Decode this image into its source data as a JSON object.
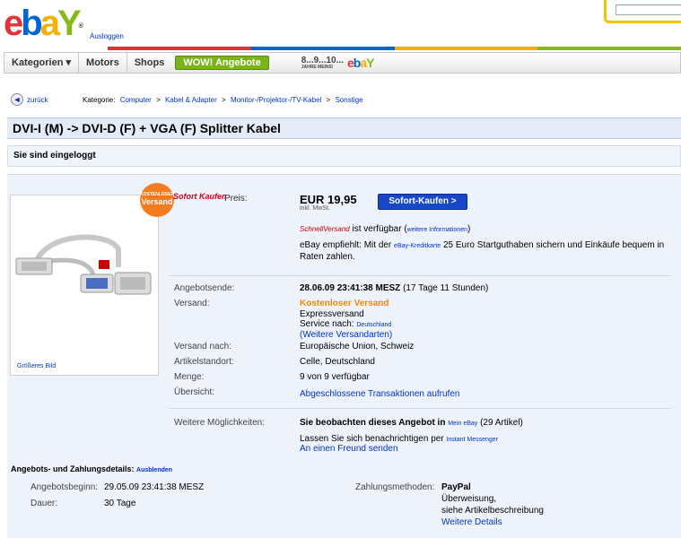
{
  "header": {
    "logout": "Ausloggen",
    "brand_colors": [
      "#e53238",
      "#0064d2",
      "#f5af02",
      "#86b817"
    ],
    "search_placeholder": ""
  },
  "nav": {
    "items": [
      "Kategorien ▾",
      "Motors",
      "Shops"
    ],
    "wow": "WOW! Angebote",
    "anniversary_numbers": "8...9...10...",
    "anniversary_sub": "JAHRE MEINS!"
  },
  "breadcrumb": {
    "back": "zurück",
    "label": "Kategorie:",
    "items": [
      "Computer",
      "Kabel & Adapter",
      "Monitor-/Projektor-/TV-Kabel",
      "Sonstige"
    ],
    "separator": ">"
  },
  "title": "DVI-I (M) -> DVI-D (F) + VGA (F) Splitter Kabel",
  "logged_in": "Sie sind eingeloggt",
  "item": {
    "bigger_image": "Größeres Bild",
    "badge_top": "KOSTENLOSER",
    "badge_main": "Versand",
    "sofort_logo": "Sofort Kaufen",
    "price_label": "Preis:",
    "price": "EUR 19,95",
    "vat": "inkl. MwSt.",
    "buy_button": "Sofort-Kaufen >",
    "schnell_logo": "SchnellVersand",
    "schnell_text": "ist verfügbar (",
    "schnell_link": "weitere Informationen",
    "schnell_close": ")",
    "recommend_1": "eBay empfiehlt: Mit der ",
    "recommend_link": "eBay-Kreditkarte",
    "recommend_2": " 25 Euro Startguthaben sichern und Einkäufe bequem in Raten zahlen.",
    "end_label": "Angebotsende:",
    "end_value": "28.06.09 23:41:38 MESZ",
    "end_remaining": "(17 Tage 11 Stunden)",
    "shipping_label": "Versand:",
    "shipping_free": "Kostenloser Versand",
    "shipping_express": "Expressversand",
    "shipping_service": "Service nach:",
    "shipping_service_link": "Deutschland",
    "shipping_more": "(Weitere Versandarten)",
    "ship_to_label": "Versand nach:",
    "ship_to_value": "Europäische Union, Schweiz",
    "location_label": "Artikelstandort:",
    "location_value": "Celle, Deutschland",
    "quantity_label": "Menge:",
    "quantity_value": "9 von 9 verfügbar",
    "overview_label": "Übersicht:",
    "overview_link": "Abgeschlossene Transaktionen aufrufen",
    "more_label": "Weitere Möglichkeiten:",
    "watch_text": "Sie beobachten dieses Angebot in",
    "watch_link": "Mein eBay",
    "watch_count": "(29 Artikel)",
    "notify_text": "Lassen Sie sich benachrichtigen per",
    "notify_link": "Instant Messenger",
    "send_friend": "An einen Freund senden"
  },
  "details": {
    "heading": "Angebots- und Zahlungsdetails:",
    "hide_link": "Ausblenden",
    "start_label": "Angebotsbeginn:",
    "start_value": "29.05.09 23:41:38 MESZ",
    "duration_label": "Dauer:",
    "duration_value": "30 Tage",
    "payment_label": "Zahlungsmethoden:",
    "payment_1": "PayPal",
    "payment_2": "Überweisung,",
    "payment_3": "siehe Artikelbeschreibung",
    "payment_more": "Weitere Details"
  }
}
